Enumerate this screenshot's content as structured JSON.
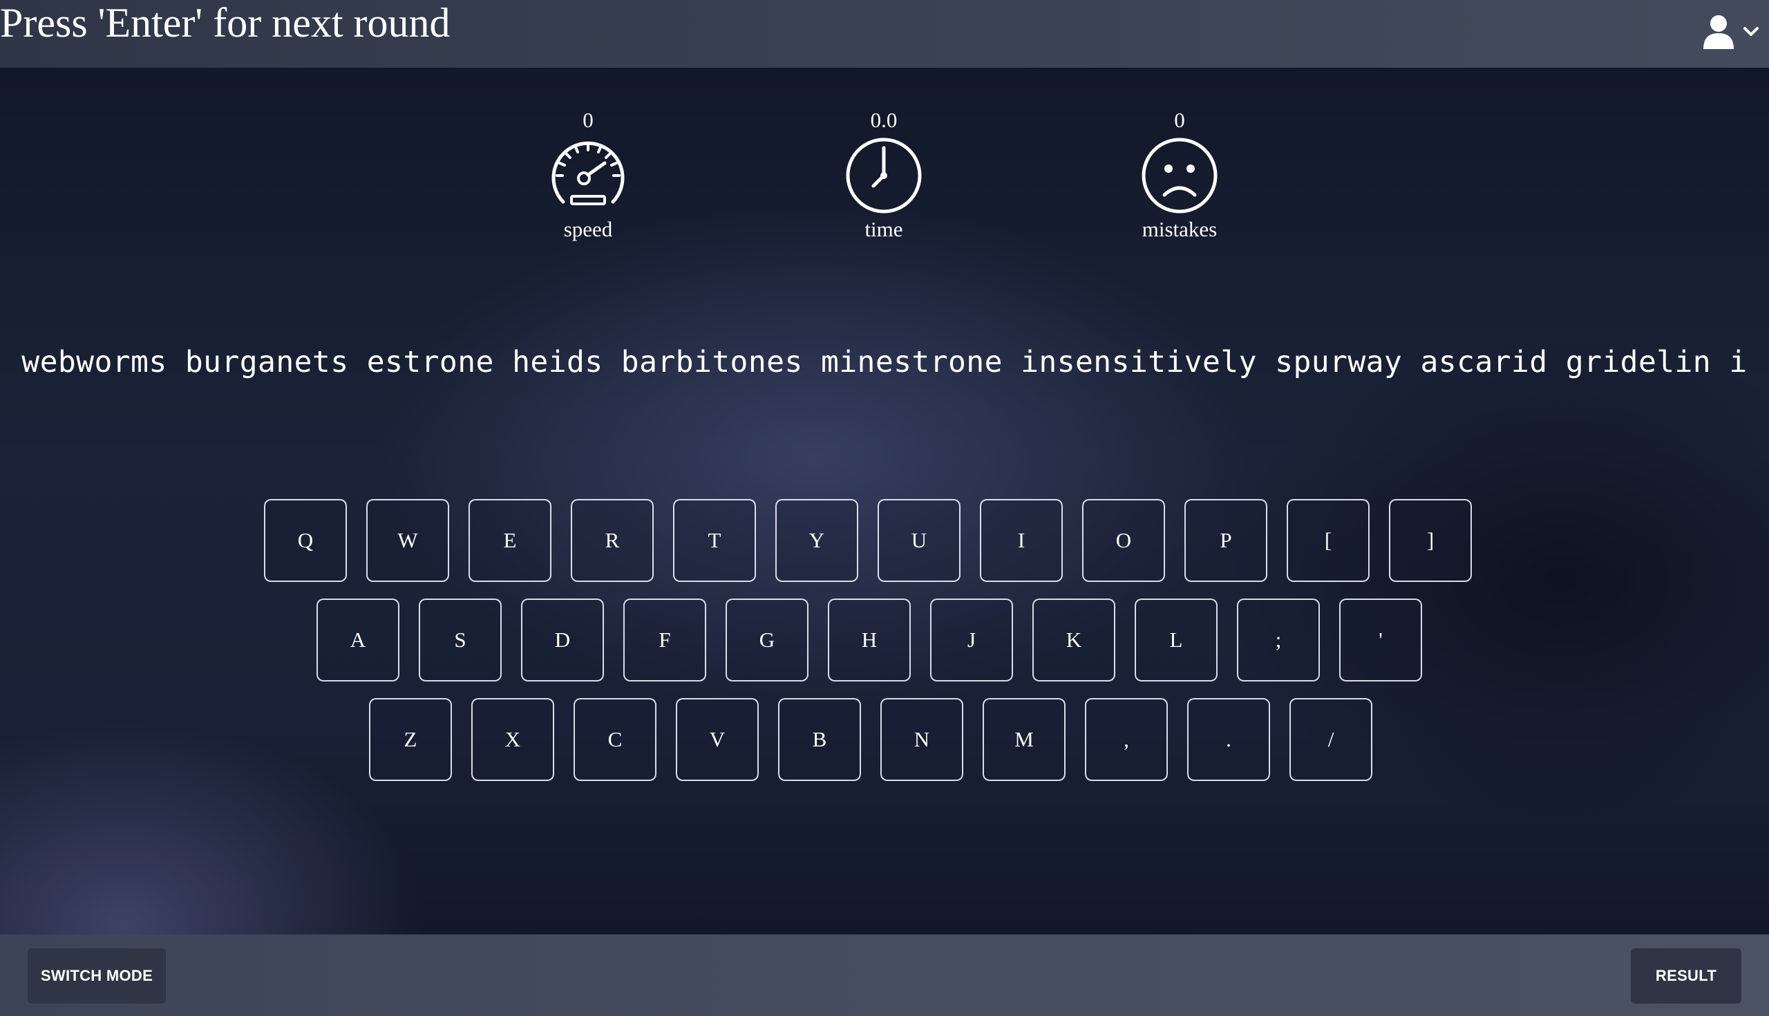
{
  "header": {
    "title": "Press 'Enter' for next round",
    "user_icon": "user-icon",
    "dropdown_icon": "chevron-down-icon"
  },
  "stats": {
    "speed": {
      "value": "0",
      "label": "speed",
      "icon": "speedometer-icon"
    },
    "time": {
      "value": "0.0",
      "label": "time",
      "icon": "clock-icon"
    },
    "mistakes": {
      "value": "0",
      "label": "mistakes",
      "icon": "sad-face-icon"
    }
  },
  "typing": {
    "text": "webworms burganets estrone heids barbitones minestrone insensitively spurway ascarid gridelin i"
  },
  "keyboard": {
    "row1": [
      "Q",
      "W",
      "E",
      "R",
      "T",
      "Y",
      "U",
      "I",
      "O",
      "P",
      "[",
      "]"
    ],
    "row2": [
      "A",
      "S",
      "D",
      "F",
      "G",
      "H",
      "J",
      "K",
      "L",
      ";",
      "'"
    ],
    "row3": [
      "Z",
      "X",
      "C",
      "V",
      "B",
      "N",
      "M",
      ",",
      ".",
      "/"
    ]
  },
  "footer": {
    "switch_mode_label": "SWITCH MODE",
    "result_label": "RESULT"
  },
  "colors": {
    "header_bg": "#394152",
    "main_bg": "#1b2338",
    "footer_bg": "#454d5f",
    "button_bg": "#2f3545",
    "text": "#ffffff"
  }
}
